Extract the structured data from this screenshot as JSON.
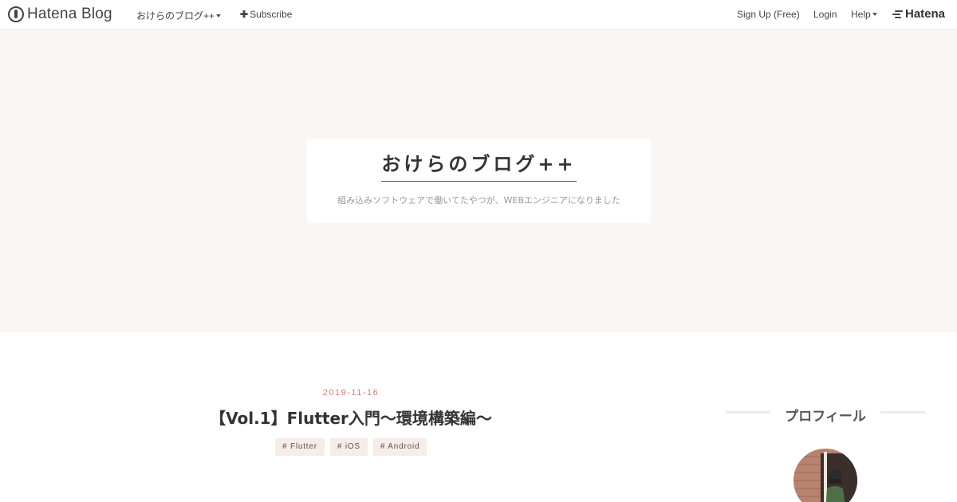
{
  "topbar": {
    "logo_text": "Hatena Blog",
    "blog_menu_label": "おけらのブログ++",
    "subscribe_label": "Subscribe",
    "signup_label": "Sign Up (Free)",
    "login_label": "Login",
    "help_label": "Help",
    "hatena_label": "Hatena"
  },
  "header": {
    "title": "おけらのブログ++",
    "description": "組み込みソフトウェアで働いてたやつが、WEBエンジニアになりました"
  },
  "entry": {
    "date": "2019-11-16",
    "title": "【Vol.1】Flutter入門〜環境構築編〜",
    "tags": [
      "# Flutter",
      "# iOS",
      "# Android"
    ]
  },
  "sidebar": {
    "profile_heading": "プロフィール"
  },
  "colors": {
    "header_bg": "#faf6f3",
    "date_accent": "#d3826b",
    "tag_bg": "#f7ece8"
  },
  "icons": {
    "logo": "hatena-blog-logo-icon",
    "caret": "caret-down-icon",
    "plus": "plus-icon",
    "hatena": "hatena-logo-icon"
  }
}
